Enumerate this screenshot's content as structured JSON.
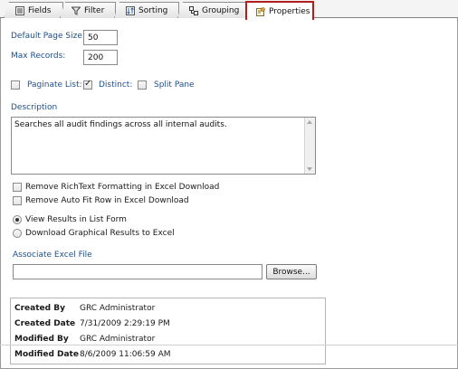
{
  "tabs": [
    {
      "label": "Fields",
      "icon": "fields-list-icon"
    },
    {
      "label": "Filter",
      "icon": "filter-funnel-icon"
    },
    {
      "label": "Sorting",
      "icon": "sorting-icon"
    },
    {
      "label": "Grouping",
      "icon": "grouping-icon"
    },
    {
      "label": "Properties",
      "icon": "properties-icon",
      "active": true
    }
  ],
  "form": {
    "default_page_size_label": "Default Page Size:",
    "default_page_size_value": "50",
    "max_records_label": "Max Records:",
    "max_records_value": "200",
    "paginate_label": "Paginate List:",
    "paginate_checked": false,
    "distinct_label": "Distinct:",
    "distinct_checked": true,
    "split_pane_label": "Split Pane",
    "split_pane_checked": false,
    "description_label": "Description",
    "description_value": "Searches all audit findings across all internal audits.",
    "remove_richtext_label": "Remove RichText Formatting in Excel Download",
    "remove_autofit_label": "Remove Auto Fit Row in Excel Download",
    "view_results_label": "View Results in List Form",
    "download_graphical_label": "Download Graphical Results to Excel",
    "view_mode_selected": "View Results in List Form",
    "associate_excel_label": "Associate Excel File",
    "associate_excel_value": "",
    "browse_label": "Browse..."
  },
  "audit": {
    "created_by_label": "Created By",
    "created_by_value": "GRC Administrator",
    "created_date_label": "Created Date",
    "created_date_value": "7/31/2009 2:29:19 PM",
    "modified_by_label": "Modified By",
    "modified_by_value": "GRC Administrator",
    "modified_date_label": "Modified Date",
    "modified_date_value": "8/6/2009 11:06:59 AM"
  },
  "colors": {
    "active_tab_border": "#b01e1e",
    "label_blue": "#1f4e8c"
  }
}
